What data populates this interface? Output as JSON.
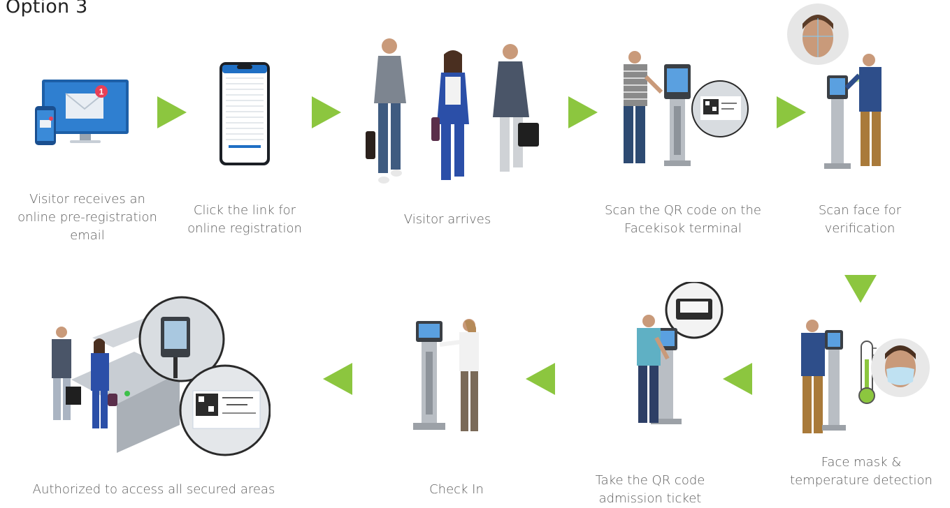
{
  "title": "Option 3",
  "accent_color": "#8cc63f",
  "steps": [
    {
      "icon": "email-notification-icon",
      "lines": [
        "Visitor receives an",
        "online pre-registration",
        "email"
      ],
      "badge": "1"
    },
    {
      "icon": "phone-form-icon",
      "lines": [
        "Click the link for",
        "online registration"
      ]
    },
    {
      "icon": "visitors-walking-image",
      "lines": [
        "Visitor arrives"
      ]
    },
    {
      "icon": "qr-scan-kiosk-image",
      "lines": [
        "Scan the QR code on the",
        "Facekisok terminal"
      ]
    },
    {
      "icon": "face-scan-kiosk-image",
      "lines": [
        "Scan face for",
        "verification"
      ]
    },
    {
      "icon": "mask-temperature-image",
      "lines": [
        "Face mask &",
        "temperature detection"
      ]
    },
    {
      "icon": "ticket-print-kiosk-image",
      "lines": [
        "Take the QR code",
        "admission ticket"
      ]
    },
    {
      "icon": "check-in-kiosk-image",
      "lines": [
        "Check In"
      ]
    },
    {
      "icon": "turnstile-access-image",
      "lines": [
        "Authorized to access all secured areas"
      ]
    }
  ]
}
